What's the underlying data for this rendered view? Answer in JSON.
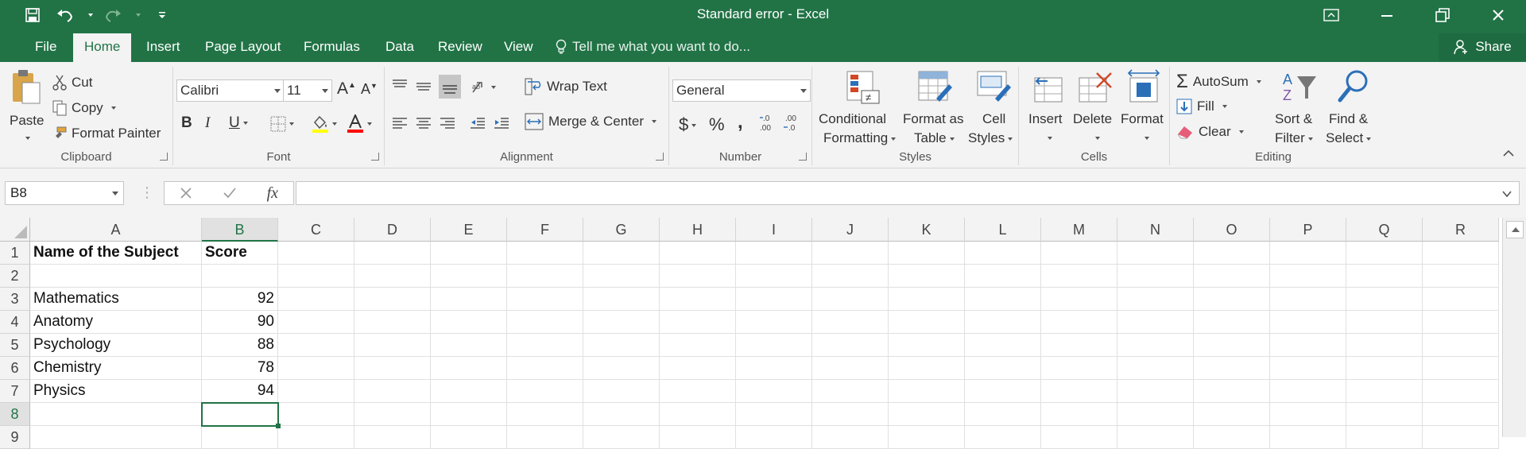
{
  "window": {
    "title": "Standard error - Excel"
  },
  "menu": {
    "tabs": [
      "File",
      "Home",
      "Insert",
      "Page Layout",
      "Formulas",
      "Data",
      "Review",
      "View"
    ],
    "active": "Home",
    "tell_me": "Tell me what you want to do...",
    "share": "Share"
  },
  "ribbon": {
    "clipboard": {
      "label": "Clipboard",
      "paste": "Paste",
      "cut": "Cut",
      "copy": "Copy",
      "format_painter": "Format Painter"
    },
    "font": {
      "label": "Font",
      "font_name": "Calibri",
      "font_size": "11",
      "grow": "A",
      "shrink": "A",
      "bold": "B",
      "italic": "I",
      "underline": "U"
    },
    "alignment": {
      "label": "Alignment",
      "wrap_text": "Wrap Text",
      "merge_center": "Merge & Center"
    },
    "number": {
      "label": "Number",
      "format": "General",
      "currency": "$",
      "percent": "%",
      "comma": ","
    },
    "styles": {
      "label": "Styles",
      "conditional_1": "Conditional",
      "conditional_2": "Formatting",
      "format_table_1": "Format as",
      "format_table_2": "Table",
      "cell_styles_1": "Cell",
      "cell_styles_2": "Styles"
    },
    "cells": {
      "label": "Cells",
      "insert": "Insert",
      "delete": "Delete",
      "format": "Format"
    },
    "editing": {
      "label": "Editing",
      "autosum": "AutoSum",
      "fill": "Fill",
      "clear": "Clear",
      "sort_1": "Sort &",
      "sort_2": "Filter",
      "find_1": "Find &",
      "find_2": "Select"
    }
  },
  "formula_bar": {
    "name_box": "B8",
    "fx": "fx",
    "formula": ""
  },
  "sheet": {
    "columns": [
      "A",
      "B",
      "C",
      "D",
      "E",
      "F",
      "G",
      "H",
      "I",
      "J",
      "K",
      "L",
      "M",
      "N",
      "O",
      "P",
      "Q",
      "R"
    ],
    "selected_column": "B",
    "rows": [
      "1",
      "2",
      "3",
      "4",
      "5",
      "6",
      "7",
      "8",
      "9"
    ],
    "selected_row": "8",
    "header_cells": {
      "a1": "Name of the Subject",
      "b1": "Score"
    },
    "data": [
      {
        "row": "3",
        "subject": "Mathematics",
        "score": "92"
      },
      {
        "row": "4",
        "subject": "Anatomy",
        "score": "90"
      },
      {
        "row": "5",
        "subject": "Psychology",
        "score": "88"
      },
      {
        "row": "6",
        "subject": "Chemistry",
        "score": "78"
      },
      {
        "row": "7",
        "subject": "Physics",
        "score": "94"
      }
    ]
  },
  "colors": {
    "brand": "#217346",
    "ribbon_bg": "#f3f3f3"
  }
}
